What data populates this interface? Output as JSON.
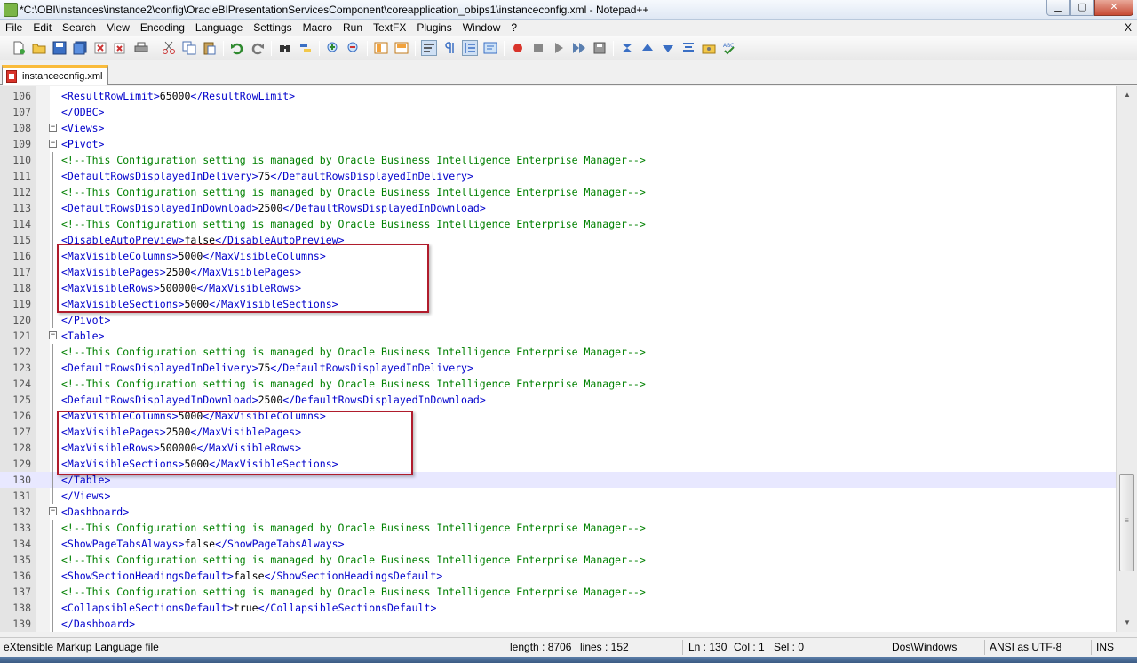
{
  "window": {
    "title": "*C:\\OBI\\instances\\instance2\\config\\OracleBIPresentationServicesComponent\\coreapplication_obips1\\instanceconfig.xml - Notepad++",
    "minimize": "▁",
    "maximize": "▢",
    "close": "✕"
  },
  "menu": {
    "items": [
      "File",
      "Edit",
      "Search",
      "View",
      "Encoding",
      "Language",
      "Settings",
      "Macro",
      "Run",
      "TextFX",
      "Plugins",
      "Window",
      "?"
    ],
    "close_doc": "X"
  },
  "tab": {
    "label": "instanceconfig.xml"
  },
  "lines": [
    {
      "n": "106",
      "parts": [
        [
          "tag",
          "<ResultRowLimit>"
        ],
        [
          "txt",
          "65000"
        ],
        [
          "tag",
          "</ResultRowLimit>"
        ]
      ]
    },
    {
      "n": "107",
      "parts": [
        [
          "tag",
          "</ODBC>"
        ]
      ]
    },
    {
      "n": "108",
      "parts": [
        [
          "tag",
          "<Views>"
        ]
      ]
    },
    {
      "n": "109",
      "parts": [
        [
          "tag",
          "<Pivot>"
        ]
      ]
    },
    {
      "n": "110",
      "parts": [
        [
          "cmt",
          "<!--This Configuration setting is managed by Oracle Business Intelligence Enterprise Manager-->"
        ]
      ]
    },
    {
      "n": "111",
      "parts": [
        [
          "tag",
          "<DefaultRowsDisplayedInDelivery>"
        ],
        [
          "txt",
          "75"
        ],
        [
          "tag",
          "</DefaultRowsDisplayedInDelivery>"
        ]
      ]
    },
    {
      "n": "112",
      "parts": [
        [
          "cmt",
          "<!--This Configuration setting is managed by Oracle Business Intelligence Enterprise Manager-->"
        ]
      ]
    },
    {
      "n": "113",
      "parts": [
        [
          "tag",
          "<DefaultRowsDisplayedInDownload>"
        ],
        [
          "txt",
          "2500"
        ],
        [
          "tag",
          "</DefaultRowsDisplayedInDownload>"
        ]
      ]
    },
    {
      "n": "114",
      "parts": [
        [
          "cmt",
          "<!--This Configuration setting is managed by Oracle Business Intelligence Enterprise Manager-->"
        ]
      ]
    },
    {
      "n": "115",
      "parts": [
        [
          "tag",
          "<DisableAutoPreview>"
        ],
        [
          "txt",
          "false"
        ],
        [
          "tag",
          "</DisableAutoPreview>"
        ]
      ]
    },
    {
      "n": "116",
      "parts": [
        [
          "tag",
          "<MaxVisibleColumns>"
        ],
        [
          "txt",
          "5000"
        ],
        [
          "tag",
          "</MaxVisibleColumns>"
        ]
      ]
    },
    {
      "n": "117",
      "parts": [
        [
          "tag",
          "<MaxVisiblePages>"
        ],
        [
          "txt",
          "2500"
        ],
        [
          "tag",
          "</MaxVisiblePages>"
        ]
      ]
    },
    {
      "n": "118",
      "parts": [
        [
          "tag",
          "<MaxVisibleRows>"
        ],
        [
          "txt",
          "500000"
        ],
        [
          "tag",
          "</MaxVisibleRows>"
        ]
      ]
    },
    {
      "n": "119",
      "parts": [
        [
          "tag",
          "<MaxVisibleSections>"
        ],
        [
          "txt",
          "5000"
        ],
        [
          "tag",
          "</MaxVisibleSections>"
        ]
      ]
    },
    {
      "n": "120",
      "parts": [
        [
          "tag",
          "</Pivot>"
        ]
      ]
    },
    {
      "n": "121",
      "parts": [
        [
          "tag",
          "<Table>"
        ]
      ]
    },
    {
      "n": "122",
      "parts": [
        [
          "cmt",
          "<!--This Configuration setting is managed by Oracle Business Intelligence Enterprise Manager-->"
        ]
      ]
    },
    {
      "n": "123",
      "parts": [
        [
          "tag",
          "<DefaultRowsDisplayedInDelivery>"
        ],
        [
          "txt",
          "75"
        ],
        [
          "tag",
          "</DefaultRowsDisplayedInDelivery>"
        ]
      ]
    },
    {
      "n": "124",
      "parts": [
        [
          "cmt",
          "<!--This Configuration setting is managed by Oracle Business Intelligence Enterprise Manager-->"
        ]
      ]
    },
    {
      "n": "125",
      "parts": [
        [
          "tag",
          "<DefaultRowsDisplayedInDownload>"
        ],
        [
          "txt",
          "2500"
        ],
        [
          "tag",
          "</DefaultRowsDisplayedInDownload>"
        ]
      ]
    },
    {
      "n": "126",
      "parts": [
        [
          "tag",
          "<MaxVisibleColumns>"
        ],
        [
          "txt",
          "5000"
        ],
        [
          "tag",
          "</MaxVisibleColumns>"
        ]
      ]
    },
    {
      "n": "127",
      "parts": [
        [
          "tag",
          "<MaxVisiblePages>"
        ],
        [
          "txt",
          "2500"
        ],
        [
          "tag",
          "</MaxVisiblePages>"
        ]
      ]
    },
    {
      "n": "128",
      "parts": [
        [
          "tag",
          "<MaxVisibleRows>"
        ],
        [
          "txt",
          "500000"
        ],
        [
          "tag",
          "</MaxVisibleRows>"
        ]
      ]
    },
    {
      "n": "129",
      "parts": [
        [
          "tag",
          "<MaxVisibleSections>"
        ],
        [
          "txt",
          "5000"
        ],
        [
          "tag",
          "</MaxVisibleSections>"
        ]
      ]
    },
    {
      "n": "130",
      "parts": [
        [
          "tag",
          "</Table>"
        ]
      ]
    },
    {
      "n": "131",
      "parts": [
        [
          "tag",
          "</Views>"
        ]
      ]
    },
    {
      "n": "132",
      "parts": [
        [
          "tag",
          "<Dashboard>"
        ]
      ]
    },
    {
      "n": "133",
      "parts": [
        [
          "cmt",
          "<!--This Configuration setting is managed by Oracle Business Intelligence Enterprise Manager-->"
        ]
      ]
    },
    {
      "n": "134",
      "parts": [
        [
          "tag",
          "<ShowPageTabsAlways>"
        ],
        [
          "txt",
          "false"
        ],
        [
          "tag",
          "</ShowPageTabsAlways>"
        ]
      ]
    },
    {
      "n": "135",
      "parts": [
        [
          "cmt",
          "<!--This Configuration setting is managed by Oracle Business Intelligence Enterprise Manager-->"
        ]
      ]
    },
    {
      "n": "136",
      "parts": [
        [
          "tag",
          "<ShowSectionHeadingsDefault>"
        ],
        [
          "txt",
          "false"
        ],
        [
          "tag",
          "</ShowSectionHeadingsDefault>"
        ]
      ]
    },
    {
      "n": "137",
      "parts": [
        [
          "cmt",
          "<!--This Configuration setting is managed by Oracle Business Intelligence Enterprise Manager-->"
        ]
      ]
    },
    {
      "n": "138",
      "parts": [
        [
          "tag",
          "<CollapsibleSectionsDefault>"
        ],
        [
          "txt",
          "true"
        ],
        [
          "tag",
          "</CollapsibleSectionsDefault>"
        ]
      ]
    },
    {
      "n": "139",
      "parts": [
        [
          "tag",
          "</Dashboard>"
        ]
      ]
    }
  ],
  "status": {
    "filetype": "eXtensible Markup Language file",
    "length": "length : 8706",
    "lines": "lines : 152",
    "ln": "Ln : 130",
    "col": "Col : 1",
    "sel": "Sel : 0",
    "eol": "Dos\\Windows",
    "encoding": "ANSI as UTF-8",
    "mode": "INS"
  },
  "colors": {
    "tag": "#0000cc",
    "comment": "#008000",
    "highlight_box": "#b01c2c",
    "current_line": "#e8e8ff",
    "tab_accent": "#fabc3c"
  }
}
